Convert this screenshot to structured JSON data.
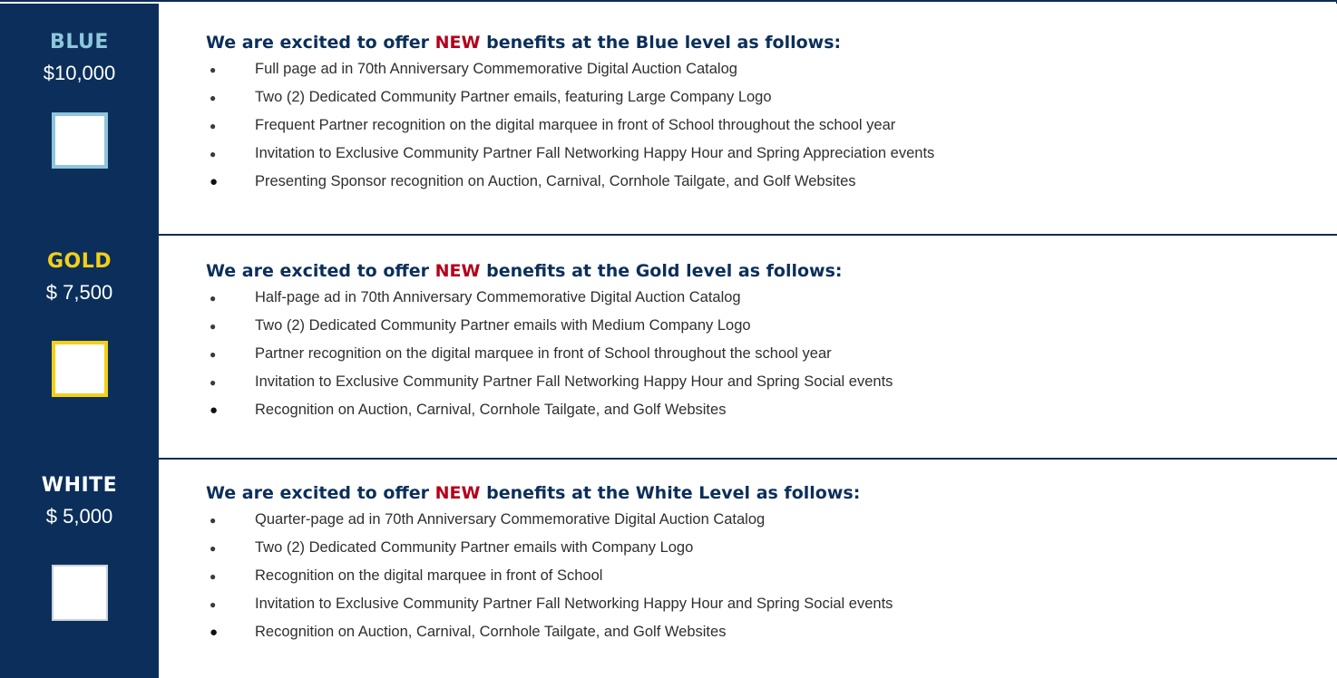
{
  "tiers": [
    {
      "name": "BLUE",
      "price": "$10,000",
      "heading_pre": "We are excited to offer ",
      "heading_new": "NEW",
      "heading_post": " benefits at the Blue level as follows:",
      "benefits": [
        "Full page ad in 70th Anniversary Commemorative Digital Auction Catalog",
        "Two (2) Dedicated Community Partner emails, featuring Large Company Logo",
        "Frequent Partner recognition on the digital marquee in front of School throughout the school year",
        "Invitation to Exclusive Community Partner Fall Networking Happy Hour and Spring Appreciation events",
        "Presenting Sponsor recognition on Auction, Carnival, Cornhole Tailgate, and Golf Websites"
      ]
    },
    {
      "name": "GOLD",
      "price": "$ 7,500",
      "heading_pre": "We are excited to offer ",
      "heading_new": "NEW",
      "heading_post": " benefits at the Gold level as follows:",
      "benefits": [
        "Half-page ad in 70th Anniversary Commemorative Digital Auction Catalog",
        "Two (2) Dedicated Community Partner emails with Medium Company Logo",
        "Partner recognition on the digital marquee in front of School throughout the school year",
        "Invitation to Exclusive Community Partner Fall Networking Happy Hour and Spring Social events",
        "Recognition on Auction, Carnival, Cornhole Tailgate, and Golf Websites"
      ]
    },
    {
      "name": "WHITE",
      "price": "$ 5,000",
      "heading_pre": "We are excited to offer ",
      "heading_new": "NEW",
      "heading_post": " benefits at the White Level as follows:",
      "benefits": [
        "Quarter-page ad in 70th Anniversary Commemorative Digital Auction Catalog",
        "Two (2) Dedicated Community Partner emails with Company Logo",
        "Recognition on the digital marquee in front of School",
        "Invitation to Exclusive Community Partner Fall Networking Happy Hour and Spring Social events",
        "Recognition on Auction, Carnival, Cornhole Tailgate, and Golf Websites"
      ]
    }
  ],
  "bullet_glyph": "●",
  "colors": {
    "navy": "#0b2f5a",
    "blue_accent": "#8ec6dc",
    "gold_accent": "#f4cf18",
    "new_red": "#b3001b"
  }
}
